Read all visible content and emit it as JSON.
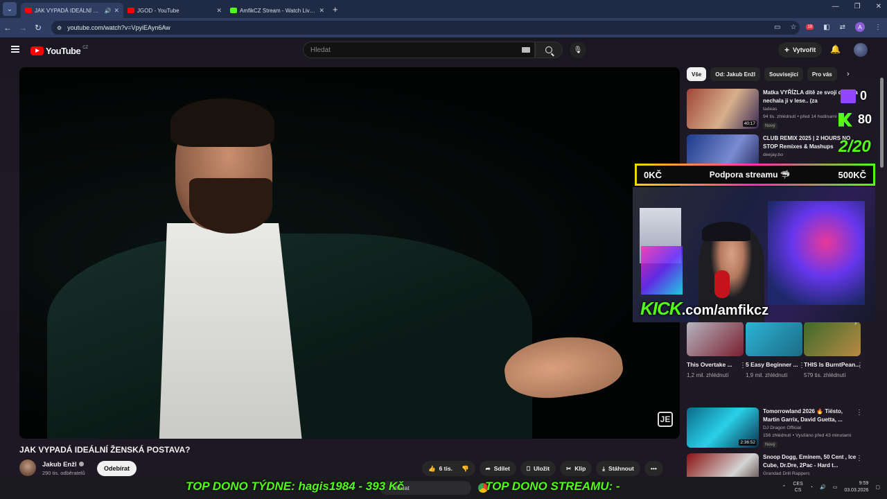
{
  "browser": {
    "tabs": [
      {
        "title": "JAK VYPADÁ IDEÁLNÍ ŽENS",
        "favicon_color": "#ff0000",
        "active": true
      },
      {
        "title": "JGOD - YouTube",
        "favicon_color": "#ff0000",
        "active": false
      },
      {
        "title": "AmfikCZ Stream - Watch Live o",
        "favicon_color": "#53fc18",
        "active": false
      }
    ],
    "url": "youtube.com/watch?v=VpyiEAyn6Aw",
    "profile_initial": "A",
    "extension_badge": "18"
  },
  "youtube": {
    "logo_text": "YouTube",
    "logo_country": "CZ",
    "search_placeholder": "Hledat",
    "create_label": "Vytvořit",
    "video_title": "JAK VYPADÁ IDEÁLNÍ ŽENSKÁ POSTAVA?",
    "channel_name": "Jakub Enžl",
    "channel_subs": "290 tis. odběratelů",
    "subscribe_label": "Odebírat",
    "actions": {
      "like_count": "6 tis.",
      "share": "Sdílet",
      "save": "Uložit",
      "clip": "Klip",
      "download": "Stáhnout"
    },
    "chips": [
      "Vše",
      "Od: Jakub Enžl",
      "Související",
      "Pro vás"
    ],
    "recommendations": [
      {
        "title": "Matka VYŘÍZLA dítě ze svojí dcery a nechala ji v lese.. (za",
        "channel": "tadeas",
        "meta": "94 tis. zhlédnutí • před 14 hodinami",
        "badge": "Nový",
        "duration": "40:17",
        "thumb_colors": [
          "#a0463a",
          "#d8b08c"
        ]
      },
      {
        "title": "CLUB REMIX 2025 | 2 HOURS NO STOP Remixes & Mashups",
        "channel": "deejay.bo",
        "meta": "",
        "badge": "",
        "duration": "",
        "thumb_colors": [
          "#1d3b8a",
          "#7a8bd1"
        ]
      }
    ],
    "shorts": [
      {
        "label": "This Overtake ...",
        "views": "1,2 mil. zhlédnutí",
        "thumb_colors": [
          "#b5b5c0",
          "#7a2030"
        ]
      },
      {
        "label": "5 Easy Beginner ...",
        "views": "1,9 mil. zhlédnutí",
        "thumb_colors": [
          "#2bb5d6",
          "#1c6b84"
        ]
      },
      {
        "label": "THIS Is BurntPean...",
        "views": "579 tis. zhlédnutí",
        "thumb_colors": [
          "#3d6a2a",
          "#b88a44"
        ]
      }
    ],
    "recommendations_lower": [
      {
        "title": "Tomorrowland 2026 🔥 Tiësto, Martin Garrix, David Guetta, ...",
        "channel": "DJ Dragon Official",
        "meta": "156 zhlédnutí • Vysíláno před 43 minutami",
        "badge": "Nový",
        "duration": "2:36:52",
        "thumb_colors": [
          "#0c6a8a",
          "#2ad0e8"
        ]
      },
      {
        "title": "Snoop Dogg, Eminem, 50 Cent , Ice Cube, Dr.Dre, 2Pac - Hard t...",
        "channel": "Grandad Drill Rappers",
        "meta": "",
        "badge": "",
        "duration": "",
        "thumb_colors": [
          "#8a1010",
          "#d4d4d4"
        ]
      }
    ]
  },
  "overlay": {
    "twitch_count": "0",
    "kick_count": "80",
    "ratio": "2/20",
    "dono_left": "0KČ",
    "dono_center": "Podpora streamu",
    "dono_right": "500KČ",
    "kick_brand": "KICK",
    "kick_url": ".com/amfikcz",
    "top_dono_week": "TOP DONO TÝDNE:  hagis1984 - 393 Kč",
    "top_dono_stream": "TOP DONO STREAMU: -"
  },
  "taskbar": {
    "search": "Hledat",
    "lang_1": "CES",
    "lang_2": "CS",
    "time": "9:59",
    "date": "03.03.2026"
  }
}
